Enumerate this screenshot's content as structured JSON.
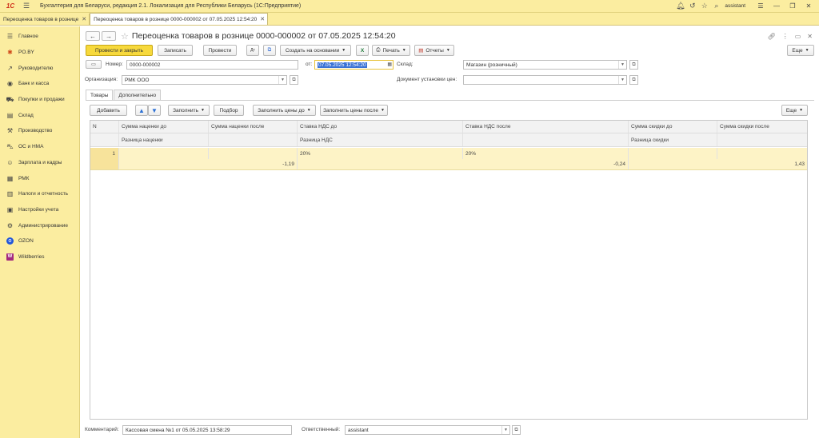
{
  "app": {
    "logo": "1С",
    "title": "Бухгалтерия для Беларуси, редакция 2.1. Локализация для Республики Беларусь   (1С:Предприятие)",
    "user": "assistant"
  },
  "window_tabs": [
    {
      "label": "Переоценка товаров в рознице"
    },
    {
      "label": "Переоценка товаров в рознице 0000-000002 от 07.05.2025 12:54:20"
    }
  ],
  "sidebar": {
    "items": [
      {
        "label": "Главное",
        "icon": "menu-icon"
      },
      {
        "label": "PO.BY",
        "icon": "po-icon"
      },
      {
        "label": "Руководителю",
        "icon": "chart-icon"
      },
      {
        "label": "Банк и касса",
        "icon": "bank-icon"
      },
      {
        "label": "Покупки и продажи",
        "icon": "cart-icon"
      },
      {
        "label": "Склад",
        "icon": "warehouse-icon"
      },
      {
        "label": "Производство",
        "icon": "factory-icon"
      },
      {
        "label": "ОС и НМА",
        "icon": "assets-icon"
      },
      {
        "label": "Зарплата и кадры",
        "icon": "people-icon"
      },
      {
        "label": "РМК",
        "icon": "pos-icon"
      },
      {
        "label": "Налоги и отчетность",
        "icon": "taxes-icon"
      },
      {
        "label": "Настройки учета",
        "icon": "settings-icon"
      },
      {
        "label": "Администрирование",
        "icon": "gear-icon"
      },
      {
        "label": "OZON",
        "icon": "ozon-icon"
      },
      {
        "label": "Wildberries",
        "icon": "wildberries-icon"
      }
    ]
  },
  "document": {
    "title": "Переоценка товаров в рознице 0000-000002 от 07.05.2025 12:54:20",
    "toolbar": {
      "post_close": "Провести и закрыть",
      "save": "Записать",
      "post": "Провести",
      "create_based": "Создать на основании",
      "print": "Печать",
      "reports": "Отчеты",
      "more": "Еще"
    },
    "fields": {
      "number_label": "Номер:",
      "number_value": "0000-000002",
      "date_label": "от:",
      "date_value": "07.05.2025 12:54:20",
      "warehouse_label": "Склад:",
      "warehouse_value": "Магазин (розничный)",
      "org_label": "Организация:",
      "org_value": "РМК ООО",
      "price_doc_label": "Документ установки цен:",
      "price_doc_value": ""
    },
    "form_tabs": [
      "Товары",
      "Дополнительно"
    ],
    "table_toolbar": {
      "add": "Добавить",
      "fill": "Заполнить",
      "pick": "Подбор",
      "fill_before": "Заполнить цены до",
      "fill_after": "Заполнить цены после",
      "more": "Еще"
    },
    "table": {
      "headers_row1": [
        "N",
        "Сумма наценки до",
        "Сумма наценки после",
        "Ставка НДС до",
        "Ставка НДС после",
        "Сумма скидки до",
        "Сумма скидки после"
      ],
      "headers_row2": [
        "",
        "Разница наценки",
        "",
        "Разница НДС",
        "",
        "Разница скидки",
        ""
      ],
      "rows": [
        {
          "n": "1",
          "line1": [
            "",
            "",
            "20%",
            "20%",
            "",
            ""
          ],
          "line2": [
            "",
            "-1,19",
            "",
            "-0,24",
            "",
            "1,43"
          ]
        }
      ]
    },
    "footer": {
      "comment_label": "Комментарий:",
      "comment_value": "Кассовая смена №1 от 05.05.2025 13:58:29",
      "responsible_label": "Ответственный:",
      "responsible_value": "assistant"
    }
  }
}
